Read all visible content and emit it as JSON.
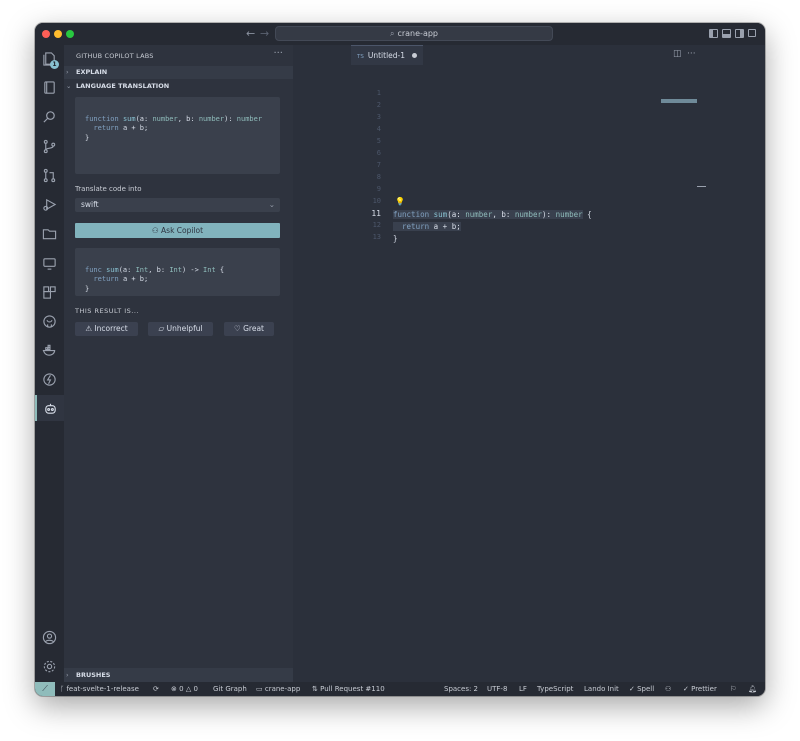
{
  "window": {
    "title": "crane-app"
  },
  "activity_bar": {
    "explorer_badge": "1"
  },
  "sidebar": {
    "title": "GITHUB COPILOT LABS",
    "more": "···",
    "sections": {
      "explain": "EXPLAIN",
      "language_translation": "LANGUAGE TRANSLATION",
      "brushes": "BRUSHES"
    },
    "source_code": {
      "line1": {
        "kw": "function",
        "name": "sum",
        "p1": "(a: ",
        "t1": "number",
        "p2": ", b: ",
        "t2": "number",
        "p3": "): ",
        "t3": "number"
      },
      "line2": {
        "kw": "return",
        "rest": " a + b;"
      },
      "line3": "}"
    },
    "translate_label": "Translate code into",
    "target_language": "swift",
    "ask_button": "Ask Copilot",
    "result_code": {
      "line1": {
        "kw": "func",
        "name": " sum",
        "p1": "(a: ",
        "t1": "Int",
        "p2": ", b: ",
        "t2": "Int",
        "p3": ") -> ",
        "t3": "Int",
        "p4": " {"
      },
      "line2": {
        "kw": "return",
        "rest": " a + b;"
      },
      "line3": "}"
    },
    "result_label": "THIS RESULT IS...",
    "feedback": {
      "incorrect": "Incorrect",
      "unhelpful": "Unhelpful",
      "great": "Great"
    }
  },
  "editor": {
    "tab": {
      "lang": "TS",
      "title": "Untitled-1"
    },
    "line_numbers": [
      "1",
      "2",
      "3",
      "4",
      "5",
      "6",
      "7",
      "8",
      "9",
      "10",
      "11",
      "12",
      "13"
    ],
    "current_line": "11",
    "code": {
      "line11": {
        "kw": "function",
        "name": " sum",
        "p1": "(a: ",
        "t1": "number",
        "p2": ", b: ",
        "t2": "number",
        "p3": "): ",
        "t3": "number",
        "p4": " {"
      },
      "line12": {
        "kw": "return",
        "rest": " a + b;"
      },
      "line13": "}"
    }
  },
  "statusbar": {
    "branch": "feat-svelte-1-release",
    "errors": "0",
    "warnings": "0",
    "git_graph": "Git Graph",
    "project": "crane-app",
    "pull_request": "Pull Request #110",
    "spaces": "Spaces: 2",
    "encoding": "UTF-8",
    "eol": "LF",
    "language": "TypeScript",
    "lando": "Lando Init",
    "spell": "Spell",
    "prettier": "Prettier"
  },
  "colors": {
    "accent": "#8fbcbb",
    "ask_button": "#81b3bd",
    "keyword": "#81a1c1",
    "function": "#88c0d0"
  }
}
